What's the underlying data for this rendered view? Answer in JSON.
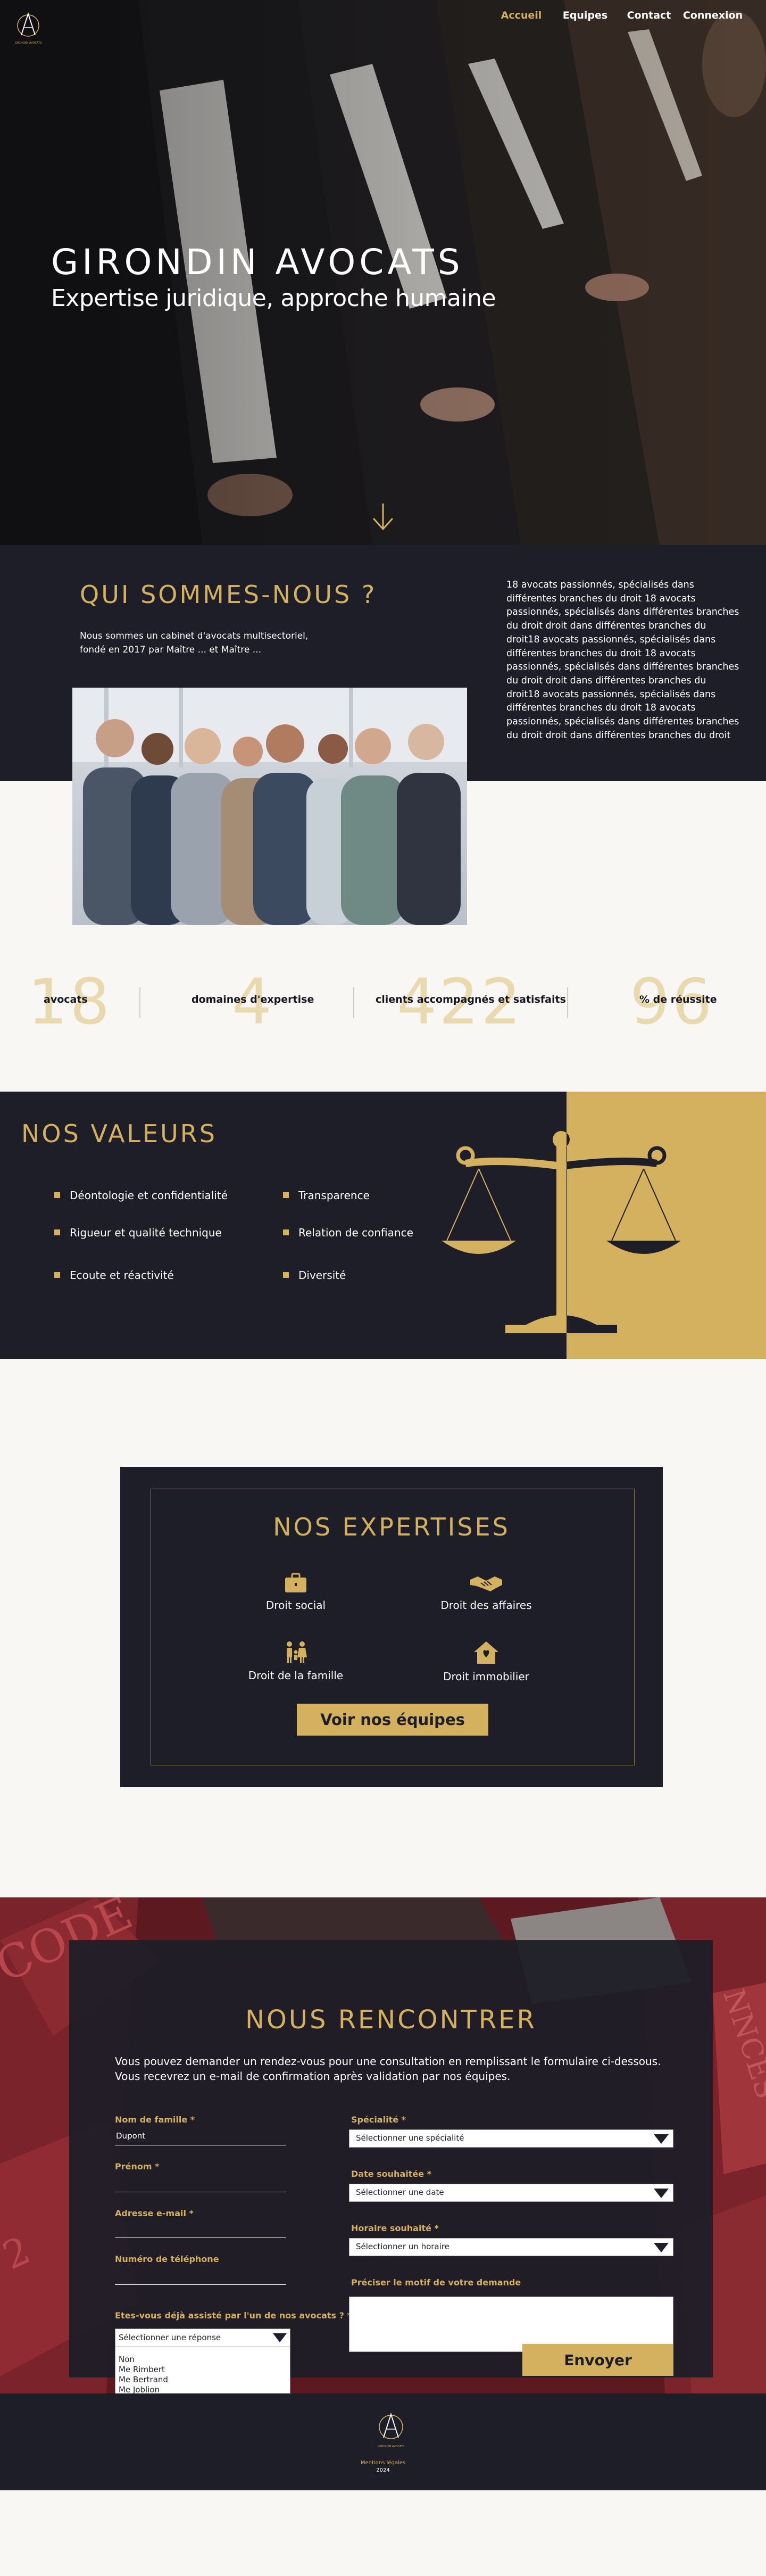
{
  "nav": {
    "items": [
      "Accueil",
      "Equipes",
      "Contact",
      "Connexion"
    ],
    "active_index": 0
  },
  "hero": {
    "title": "GIRONDIN AVOCATS",
    "subtitle": "Expertise juridique, approche humaine",
    "scroll_icon": "arrow-down-icon"
  },
  "about": {
    "heading": "QUI SOMMES-NOUS ?",
    "intro": "Nous sommes un cabinet d'avocats multisectoriel, fondé en 2017 par Maître ... et Maître ...",
    "description": "18 avocats passionnés, spécialisés dans différentes branches du droit 18 avocats passionnés, spécialisés dans différentes branches du droit droit  dans différentes branches du droit18 avocats passionnés, spécialisés dans différentes branches du droit 18 avocats passionnés, spécialisés dans différentes branches du droit droit  dans différentes branches du droit18 avocats passionnés, spécialisés dans différentes branches du droit 18 avocats passionnés, spécialisés dans différentes branches du droit droit  dans différentes branches du droit"
  },
  "stats": [
    {
      "number": "18",
      "label": "avocats"
    },
    {
      "number": "4",
      "label": "domaines d'expertise"
    },
    {
      "number": "422",
      "label": "clients accompagnés et satisfaits"
    },
    {
      "number": "96",
      "label": "% de réussite"
    }
  ],
  "values": {
    "heading": "NOS VALEURS",
    "left": [
      "Déontologie et confidentialité",
      "Rigueur et qualité technique",
      "Ecoute et réactivité"
    ],
    "right": [
      "Transparence",
      "Relation de confiance",
      "Diversité"
    ]
  },
  "expertises": {
    "heading": "NOS EXPERTISES",
    "items": [
      {
        "label": "Droit social",
        "icon": "briefcase-icon"
      },
      {
        "label": "Droit des affaires",
        "icon": "handshake-icon"
      },
      {
        "label": "Droit de la famille",
        "icon": "family-icon"
      },
      {
        "label": "Droit immobilier",
        "icon": "house-icon"
      }
    ],
    "button": "Voir nos équipes"
  },
  "contact": {
    "heading": "NOUS RENCONTRER",
    "intro": "Vous pouvez demander un rendez-vous pour une consultation en remplissant le formulaire ci-dessous. Vous recevrez un e-mail de confirmation après validation par nos équipes.",
    "fields": {
      "lastname_label": "Nom de famille *",
      "lastname_value": "Dupont",
      "firstname_label": "Prénom *",
      "email_label": "Adresse e-mail *",
      "phone_label": "Numéro de téléphone",
      "assisted_label": "Etes-vous déjà assisté par l'un de nos avocats ? *",
      "assisted_placeholder": "Sélectionner une réponse",
      "assisted_options": [
        "Non",
        "Me Rimbert",
        "Me Bertrand",
        "Me Joblion"
      ],
      "specialty_label": "Spécialité *",
      "specialty_placeholder": "Sélectionner une spécialité",
      "date_label": "Date souhaitée *",
      "date_placeholder": "Sélectionner une date",
      "time_label": "Horaire souhaité *",
      "time_placeholder": "Sélectionner un horaire",
      "reason_label": "Préciser le motif de votre demande"
    },
    "submit": "Envoyer"
  },
  "footer": {
    "credit": "Mentions légales",
    "year": "2024"
  },
  "colors": {
    "gold": "#d3b15e",
    "navy": "#1d1e27",
    "cream": "#f8f7f3",
    "stat_number": "#e9d9ae"
  }
}
